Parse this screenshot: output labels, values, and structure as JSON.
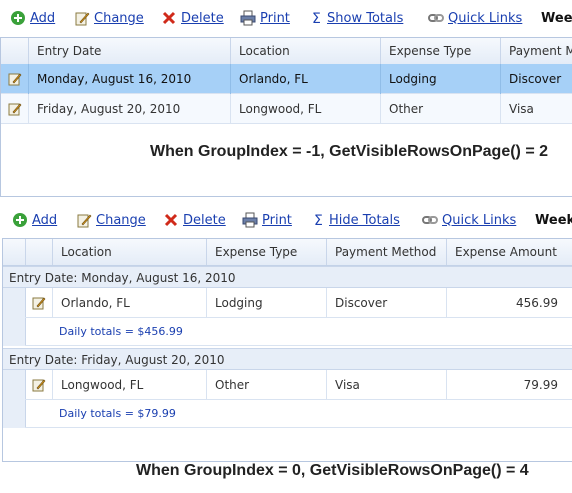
{
  "toolbar_top": {
    "add": "Add",
    "change": "Change",
    "delete": "Delete",
    "print": "Print",
    "totals": "Show Totals",
    "quick_links": "Quick Links",
    "week": "Wee"
  },
  "grid_top": {
    "columns": [
      "Entry Date",
      "Location",
      "Expense Type",
      "Payment Method"
    ],
    "rows": [
      {
        "date": "Monday, August 16, 2010",
        "location": "Orlando, FL",
        "type": "Lodging",
        "payment": "Discover"
      },
      {
        "date": "Friday, August 20, 2010",
        "location": "Longwood, FL",
        "type": "Other",
        "payment": "Visa"
      }
    ]
  },
  "caption_top": "When GroupIndex = -1, GetVisibleRowsOnPage() = 2",
  "toolbar_bottom": {
    "add": "Add",
    "change": "Change",
    "delete": "Delete",
    "print": "Print",
    "totals": "Hide Totals",
    "quick_links": "Quick Links",
    "week": "Week"
  },
  "grid_bottom": {
    "columns": [
      "Location",
      "Expense Type",
      "Payment Method",
      "Expense Amount"
    ],
    "groups": [
      {
        "label": "Entry Date:  Monday, August 16, 2010",
        "row": {
          "location": "Orlando, FL",
          "type": "Lodging",
          "payment": "Discover",
          "amount": "456.99"
        },
        "total": "Daily totals = $456.99"
      },
      {
        "label": "Entry Date:  Friday, August 20, 2010",
        "row": {
          "location": "Longwood, FL",
          "type": "Other",
          "payment": "Visa",
          "amount": "79.99"
        },
        "total": "Daily totals = $79.99"
      }
    ]
  },
  "caption_bottom": "When GroupIndex = 0, GetVisibleRowsOnPage() = 4",
  "colors": {
    "selected_row": "#a6d0f7",
    "link": "#1a3fb0",
    "header": "#e4ecf7"
  }
}
